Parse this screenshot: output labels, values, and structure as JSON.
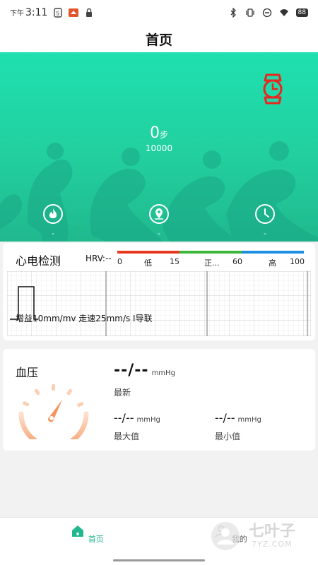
{
  "status_bar": {
    "period": "下午",
    "time": "3:11",
    "battery": "88"
  },
  "title": "首页",
  "hero": {
    "steps": "0",
    "steps_unit": "步",
    "goal": "10000",
    "metrics": [
      {
        "icon": "flame-icon",
        "value": "-"
      },
      {
        "icon": "location-pin-icon",
        "value": "-"
      },
      {
        "icon": "clock-icon",
        "value": "-"
      }
    ]
  },
  "ecg": {
    "title": "心电检测",
    "hrv_label": "HRV:--",
    "range_colors": [
      "#e8371f",
      "#3cb73c",
      "#1e8fe0"
    ],
    "range_labels": [
      "0",
      "低",
      "15",
      "正...",
      "60",
      "高",
      "100"
    ],
    "gain_text": "增益10mm/mv 走速25mm/s Ⅰ导联"
  },
  "blood_pressure": {
    "title": "血压",
    "latest_value": "--/--",
    "latest_unit": "mmHg",
    "latest_label": "最新",
    "max_value": "--/--",
    "max_unit": "mmHg",
    "max_label": "最大值",
    "min_value": "--/--",
    "min_unit": "mmHg",
    "min_label": "最小值"
  },
  "nav": {
    "home_label": "首页",
    "mine_label": "我的"
  },
  "watermark": {
    "text": "七叶子",
    "sub": "7YZ.COM"
  },
  "colors": {
    "accent": "#21cf9f",
    "watch": "#e8271f",
    "gauge": "#f9a878"
  }
}
